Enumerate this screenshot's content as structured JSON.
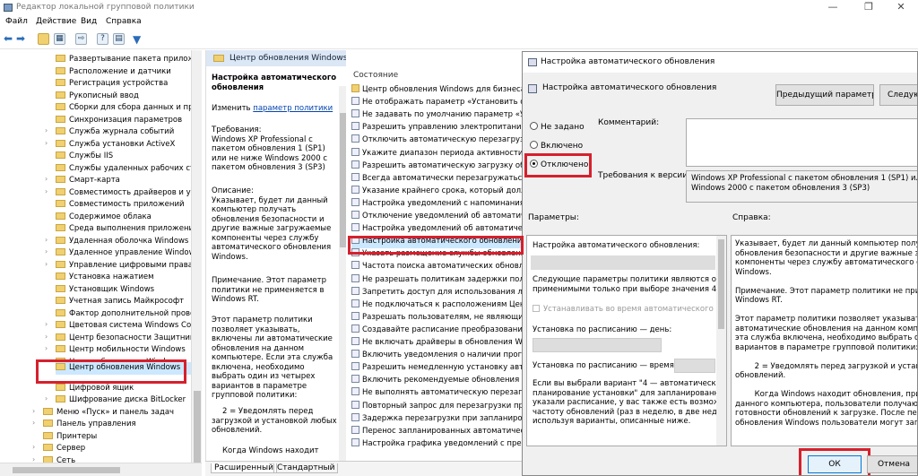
{
  "window": {
    "title": "Редактор локальной групповой политики",
    "minimize": "—",
    "maximize": "❐",
    "close": "✕"
  },
  "menu": [
    "Файл",
    "Действие",
    "Вид",
    "Справка"
  ],
  "tree": [
    "Развертывание пакета приложен",
    "Расположение и датчики",
    "Регистрация устройства",
    "Рукописный ввод",
    "Сборки для сбора данных и пред",
    "Синхронизация параметров",
    "Служба журнала событий",
    "Служба установки ActiveX",
    "Службы IIS",
    "Службы удаленных рабочих стол",
    "Смарт-карта",
    "Совместимость драйверов и устр",
    "Совместимость приложений",
    "Содержимое облака",
    "Среда выполнения приложения",
    "Удаленная оболочка Windows",
    "Удаленное управление Windows",
    "Управление цифровыми правам",
    "Установка нажатием",
    "Установщик Windows",
    "Учетная запись Майкрософт",
    "Фактор дополнительной провер",
    "Цветовая система Windows Color",
    "Центр безопасности Защитника",
    "Центр мобильности Windows",
    "Центр обновления Windows",
    "Центр обновления Windows",
    "Цифровой ящик",
    "Шифрование диска BitLocker",
    "Меню «Пуск» и панель задач",
    "Панель управления",
    "Принтеры",
    "Сервер",
    "Сеть"
  ],
  "middle": {
    "header": "Центр обновления Windows",
    "title": "Настройка автоматического обновления",
    "edit_prefix": "Изменить",
    "edit_link": "параметр политики",
    "requirements": "Требования:\nWindows XP Professional с пакетом обновления 1 (SP1) или не ниже Windows 2000 с пакетом обновления 3 (SP3)",
    "description": "Описание:\nУказывает, будет ли данный компьютер получать обновления безопасности и другие важные загружаемые компоненты через службу автоматического обновления Windows.",
    "note": "Примечание. Этот параметр политики не применяется в Windows RT.",
    "body": "Этот параметр политики позволяет указывать, включены ли автоматические обновления на данном компьютере. Если эта служба включена, необходимо выбрать один из четырех вариантов в параметре групповой политики:",
    "option2": "2 = Уведомлять перед загрузкой и установкой любых обновлений.",
    "tail": "Когда Windows находит"
  },
  "list": {
    "header": "Состояние",
    "items": [
      "Центр обновления Windows для бизнеса",
      "Не отображать параметр «Установить обн",
      "Не задавать по умолчанию параметр «Уст",
      "Разрешить управлению электропитанием",
      "Отключить автоматическую перезагрузку",
      "Укажите диапазон периода активности д",
      "Разрешить автоматическую загрузку обн",
      "Всегда автоматически перезагружаться в",
      "Указание крайнего срока, который долже",
      "Настройка уведомлений с напоминаниям",
      "Отключение уведомлений об автоматичес",
      "Настройка уведомлений об автоматическ",
      "Настройка автоматического обновления",
      "Указать размещение службы обновлений",
      "Частота поиска автоматических обновлен",
      "Не разрешать политикам задержки получ",
      "Запретить доступ для использования люб",
      "Не подключаться к расположениям Центр",
      "Разрешать пользователям, не являющимс",
      "Создавайте расписание преобразований",
      "Не включать драйверы в обновления Win",
      "Включить уведомления о наличии програ",
      "Разрешить немедленную установку автом",
      "Включить рекомендуемые обновления чер",
      "Не выполнять автоматическую перезагру",
      "Повторный запрос для перезагрузки при",
      "Задержка перезагрузки при запланирован",
      "Перенос запланированных автоматически",
      "Настройка графика уведомлений с предуп"
    ]
  },
  "tabs": [
    "Расширенный",
    "Стандартный"
  ],
  "dialog": {
    "title": "Настройка автоматического обновления",
    "subtitle": "Настройка автоматического обновления",
    "prev_button": "Предыдущий параметр",
    "next_button": "Следую",
    "radio_not_set": "Не задано",
    "radio_enabled": "Включено",
    "radio_disabled": "Отключено",
    "comment_label": "Комментарий:",
    "req_label": "Требования к версии:",
    "req_text": "Windows XP Professional с пакетом обновления 1 (SP1) или не\nWindows 2000 с пакетом обновления 3 (SP3)",
    "params_label": "Параметры:",
    "help_label": "Справка:",
    "params_title": "Настройка автоматического обновления:",
    "params_note": "Следующие параметры политики являются обяза\nприменимыми только при выборе значения 4.",
    "params_checkbox": "Устанавливать во время автоматического обсл",
    "params_day": "Установка по расписанию — день:",
    "params_time": "Установка по расписанию — время:",
    "params_variant": "Если вы выбрали вариант \"4 — автоматическое с\nпланирование установки\" для запланированного\nуказали расписание, у вас также есть возможност\nчастоту обновлений (раз в неделю, в две недели и\nиспользуя варианты, описанные ниже.",
    "help_text": "Указывает, будет ли данный компьютер получать\nобновления безопасности и другие важные загруж\nкомпоненты через службу автоматического обновл\nWindows.\n\nПримечание. Этот параметр политики не примен\nWindows RT.\n\nЭтот параметр политики позволяет указывать, вкл\nавтоматические обновления на данном компьют\nэта служба включена, необходимо выбрать оди\nвариантов в параметре групповой политики:\n\n        2 = Уведомлять перед загрузкой и установкой\nобновлений.\n\n        Когда Windows находит обновления, примен\nданного компьютера, пользователи получают у\nготовности обновлений к загрузке. После переход\nобновления Windows пользователи могут загру",
    "ok_button": "ОК",
    "cancel_button": "Отмена"
  }
}
